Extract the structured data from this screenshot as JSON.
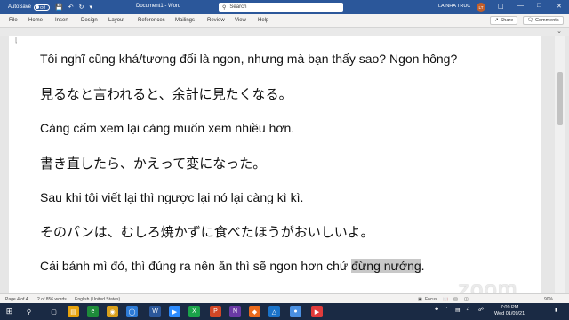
{
  "titlebar": {
    "autosave_label": "AutoSave",
    "autosave_state": "Off",
    "document_title": "Document1 - Word",
    "search_placeholder": "Search",
    "user_name": "LAINHA TRUC",
    "user_initials": "LT"
  },
  "ribbon": {
    "tabs": [
      "File",
      "Home",
      "Insert",
      "Design",
      "Layout",
      "References",
      "Mailings",
      "Review",
      "View",
      "Help"
    ],
    "share_label": "Share",
    "comments_label": "Comments"
  },
  "document": {
    "lines": [
      "Tôi nghĩ cũng khá/tương đối là ngon, nhưng mà bạn thấy sao? Ngon hông?",
      "見るなと言われると、余計に見たくなる。",
      "Càng cấm xem lại càng muốn xem nhiều hơn.",
      "書き直したら、かえって変になった。",
      "Sau khi tôi viết lại thì ngược lại nó lại càng kì kì.",
      "そのパンは、むしろ焼かずに食べたほうがおいしいよ。",
      "Cái bánh mì đó, thì đúng ra nên ăn thì sẽ ngon hơn chứ ",
      "đừng nướng"
    ],
    "last_line_end": "."
  },
  "statusbar": {
    "page": "Page 4 of 4",
    "words": "2 of 856 words",
    "language": "English (United States)",
    "focus": "Focus",
    "zoom_percent": "90%"
  },
  "zoom_watermark": "zoom",
  "taskbar": {
    "time": "7:09 PM",
    "date": "Wed 01/09/21"
  }
}
